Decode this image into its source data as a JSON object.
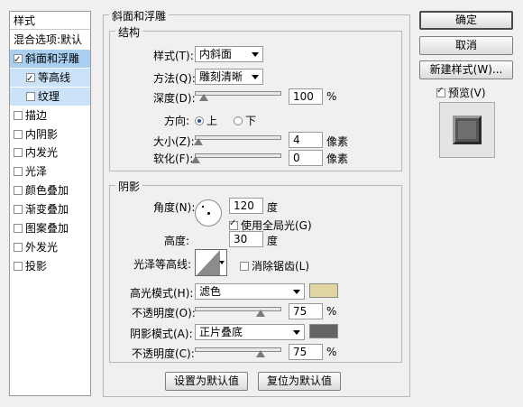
{
  "sidebar": {
    "header": "样式",
    "items": [
      {
        "label": "混合选项:默认",
        "checkbox": false,
        "checked": false
      },
      {
        "label": "斜面和浮雕",
        "checkbox": true,
        "checked": true
      },
      {
        "label": "等高线",
        "checkbox": true,
        "checked": true
      },
      {
        "label": "纹理",
        "checkbox": true,
        "checked": false
      },
      {
        "label": "描边",
        "checkbox": true,
        "checked": false
      },
      {
        "label": "内阴影",
        "checkbox": true,
        "checked": false
      },
      {
        "label": "内发光",
        "checkbox": true,
        "checked": false
      },
      {
        "label": "光泽",
        "checkbox": true,
        "checked": false
      },
      {
        "label": "颜色叠加",
        "checkbox": true,
        "checked": false
      },
      {
        "label": "渐变叠加",
        "checkbox": true,
        "checked": false
      },
      {
        "label": "图案叠加",
        "checkbox": true,
        "checked": false
      },
      {
        "label": "外发光",
        "checkbox": true,
        "checked": false
      },
      {
        "label": "投影",
        "checkbox": true,
        "checked": false
      }
    ]
  },
  "bevel": {
    "group_title": "斜面和浮雕",
    "structure_title": "结构",
    "style_label": "样式(T):",
    "style_value": "内斜面",
    "technique_label": "方法(Q):",
    "technique_value": "雕刻清晰",
    "depth_label": "深度(D):",
    "depth_value": "100",
    "depth_unit": "%",
    "direction_label": "方向:",
    "dir_up": "上",
    "dir_down": "下",
    "size_label": "大小(Z):",
    "size_value": "4",
    "size_unit": "像素",
    "soften_label": "软化(F):",
    "soften_value": "0",
    "soften_unit": "像素"
  },
  "shading": {
    "title": "阴影",
    "angle_label": "角度(N):",
    "angle_value": "120",
    "angle_unit": "度",
    "global_light_label": "使用全局光(G)",
    "altitude_label": "高度:",
    "altitude_value": "30",
    "altitude_unit": "度",
    "gloss_label": "光泽等高线:",
    "antialias_label": "消除锯齿(L)",
    "highlight_mode_label": "高光模式(H):",
    "highlight_mode_value": "滤色",
    "highlight_color": "#e1d5a3",
    "highlight_opacity_label": "不透明度(O):",
    "highlight_opacity_value": "75",
    "shadow_mode_label": "阴影模式(A):",
    "shadow_mode_value": "正片叠底",
    "shadow_color": "#646464",
    "shadow_opacity_label": "不透明度(C):",
    "shadow_opacity_value": "75",
    "percent": "%"
  },
  "footer": {
    "make_default": "设置为默认值",
    "reset_default": "复位为默认值"
  },
  "right": {
    "ok": "确定",
    "cancel": "取消",
    "new_style": "新建样式(W)...",
    "preview": "预览(V)"
  }
}
